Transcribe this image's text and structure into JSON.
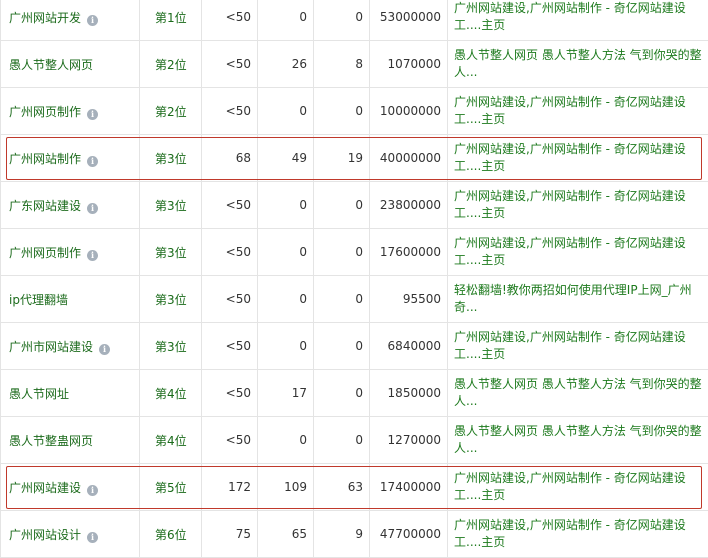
{
  "rows": [
    {
      "keyword": "广州网站开发",
      "info": true,
      "rank": "第1位",
      "index": "<50",
      "a": "0",
      "b": "0",
      "results": "53000000",
      "title": "广州网站建设,广州网站制作 - 奇亿网站建设工....主页"
    },
    {
      "keyword": "愚人节整人网页",
      "info": false,
      "rank": "第2位",
      "index": "<50",
      "a": "26",
      "b": "8",
      "results": "1070000",
      "title": "愚人节整人网页 愚人节整人方法 气到你哭的整人..."
    },
    {
      "keyword": "广州网页制作",
      "info": true,
      "rank": "第2位",
      "index": "<50",
      "a": "0",
      "b": "0",
      "results": "10000000",
      "title": "广州网站建设,广州网站制作 - 奇亿网站建设工....主页"
    },
    {
      "keyword": "广州网站制作",
      "info": true,
      "rank": "第3位",
      "index": "68",
      "a": "49",
      "b": "19",
      "results": "40000000",
      "title": "广州网站建设,广州网站制作 - 奇亿网站建设工....主页"
    },
    {
      "keyword": "广东网站建设",
      "info": true,
      "rank": "第3位",
      "index": "<50",
      "a": "0",
      "b": "0",
      "results": "23800000",
      "title": "广州网站建设,广州网站制作 - 奇亿网站建设工....主页"
    },
    {
      "keyword": "广州网页制作",
      "info": true,
      "rank": "第3位",
      "index": "<50",
      "a": "0",
      "b": "0",
      "results": "17600000",
      "title": "广州网站建设,广州网站制作 - 奇亿网站建设工....主页"
    },
    {
      "keyword": "ip代理翻墙",
      "info": false,
      "rank": "第3位",
      "index": "<50",
      "a": "0",
      "b": "0",
      "results": "95500",
      "title": "轻松翻墙!教你两招如何使用代理IP上网_广州奇..."
    },
    {
      "keyword": "广州市网站建设",
      "info": true,
      "rank": "第3位",
      "index": "<50",
      "a": "0",
      "b": "0",
      "results": "6840000",
      "title": "广州网站建设,广州网站制作 - 奇亿网站建设工....主页"
    },
    {
      "keyword": "愚人节网址",
      "info": false,
      "rank": "第4位",
      "index": "<50",
      "a": "17",
      "b": "0",
      "results": "1850000",
      "title": "愚人节整人网页 愚人节整人方法 气到你哭的整人..."
    },
    {
      "keyword": "愚人节整蛊网页",
      "info": false,
      "rank": "第4位",
      "index": "<50",
      "a": "0",
      "b": "0",
      "results": "1270000",
      "title": "愚人节整人网页 愚人节整人方法 气到你哭的整人..."
    },
    {
      "keyword": "广州网站建设",
      "info": true,
      "rank": "第5位",
      "index": "172",
      "a": "109",
      "b": "63",
      "results": "17400000",
      "title": "广州网站建设,广州网站制作 - 奇亿网站建设工....主页"
    },
    {
      "keyword": "广州网站设计",
      "info": true,
      "rank": "第6位",
      "index": "75",
      "a": "65",
      "b": "9",
      "results": "47700000",
      "title": "广州网站建设,广州网站制作 - 奇亿网站建设工....主页"
    }
  ],
  "highlighted_rows": [
    3,
    10
  ],
  "colors": {
    "keyword": "#1c6b1c",
    "title": "#1d7a1d",
    "highlight": "#c0392b",
    "border": "#e4e4e4"
  }
}
